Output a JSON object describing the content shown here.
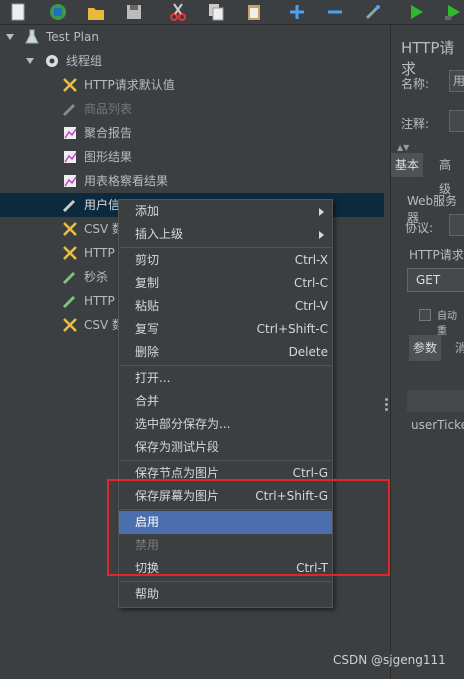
{
  "tree": {
    "root": "Test Plan",
    "thread_group": "线程组",
    "items": [
      {
        "label": "HTTP请求默认值",
        "icon": "wrench-icon",
        "disabled": false
      },
      {
        "label": "商品列表",
        "icon": "pipette-icon",
        "disabled": true
      },
      {
        "label": "聚合报告",
        "icon": "chart-icon",
        "disabled": false
      },
      {
        "label": "图形结果",
        "icon": "chart-icon",
        "disabled": false
      },
      {
        "label": "用表格察看结果",
        "icon": "chart-icon",
        "disabled": false
      },
      {
        "label": "用户信",
        "icon": "pipette-icon",
        "disabled": false
      },
      {
        "label": "CSV 数",
        "icon": "wrench-icon",
        "disabled": false
      },
      {
        "label": "HTTP",
        "icon": "wrench-icon",
        "disabled": false
      },
      {
        "label": "秒杀",
        "icon": "pipette-icon",
        "disabled": false
      },
      {
        "label": "HTTP",
        "icon": "pipette-icon",
        "disabled": false
      },
      {
        "label": "CSV 数",
        "icon": "wrench-icon",
        "disabled": false
      }
    ]
  },
  "context_menu": {
    "items": [
      {
        "label": "添加",
        "shortcut": "",
        "submenu": true
      },
      {
        "label": "插入上级",
        "shortcut": "",
        "submenu": true
      },
      {
        "label": "剪切",
        "shortcut": "Ctrl-X"
      },
      {
        "label": "复制",
        "shortcut": "Ctrl-C"
      },
      {
        "label": "粘贴",
        "shortcut": "Ctrl-V"
      },
      {
        "label": "复写",
        "shortcut": "Ctrl+Shift-C"
      },
      {
        "label": "删除",
        "shortcut": "Delete"
      },
      {
        "label": "打开...",
        "shortcut": ""
      },
      {
        "label": "合并",
        "shortcut": ""
      },
      {
        "label": "选中部分保存为...",
        "shortcut": ""
      },
      {
        "label": "保存为测试片段",
        "shortcut": ""
      },
      {
        "label": "保存节点为图片",
        "shortcut": "Ctrl-G"
      },
      {
        "label": "保存屏幕为图片",
        "shortcut": "Ctrl+Shift-G"
      },
      {
        "label": "启用",
        "shortcut": "",
        "highlighted": true
      },
      {
        "label": "禁用",
        "shortcut": "",
        "disabled": true
      },
      {
        "label": "切换",
        "shortcut": "Ctrl-T"
      },
      {
        "label": "帮助",
        "shortcut": ""
      }
    ]
  },
  "right_panel": {
    "title": "HTTP请求",
    "name_label": "名称:",
    "name_value": "用",
    "comment_label": "注释:",
    "tab_basic": "基本",
    "tab_advanced": "高级",
    "web_server_label": "Web服务器",
    "protocol_label": "协议:",
    "http_request_label": "HTTP请求",
    "method_value": "GET",
    "auto_label": "自动重",
    "params_tab": "参数",
    "body_tab": "消",
    "param_value": "userTicke"
  },
  "watermark": "CSDN @sjgeng111",
  "colors": {
    "highlight": "#4b6eaf",
    "annotation_box": "#e0262b",
    "selection": "#0d293e"
  }
}
